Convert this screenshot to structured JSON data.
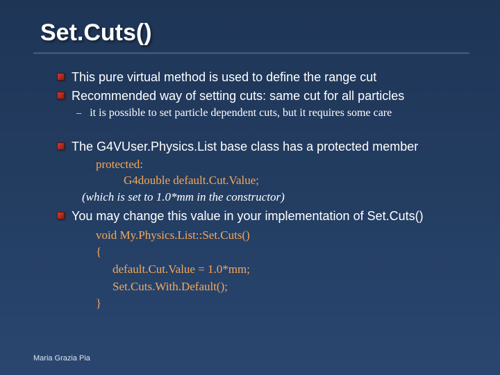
{
  "title": "Set.Cuts()",
  "bullets": {
    "b1": "This pure virtual method is used to define the range cut",
    "b2": "Recommended way of setting cuts: same cut for all particles",
    "b2a": "it is possible to set particle dependent cuts, but it requires some care",
    "b3": "The G4VUser.Physics.List base class has a protected member",
    "b4": "You may change this value in your implementation of Set.Cuts()"
  },
  "code1": {
    "l1": "protected:",
    "l2": "G4double default.Cut.Value;"
  },
  "note": "(which is set to 1.0*mm in the constructor)",
  "code2": {
    "l1": "void My.Physics.List::Set.Cuts()",
    "l2": "{",
    "l3": "default.Cut.Value = 1.0*mm;",
    "l4": "Set.Cuts.With.Default();",
    "l5": "}"
  },
  "footer": "Maria Grazia Pia"
}
